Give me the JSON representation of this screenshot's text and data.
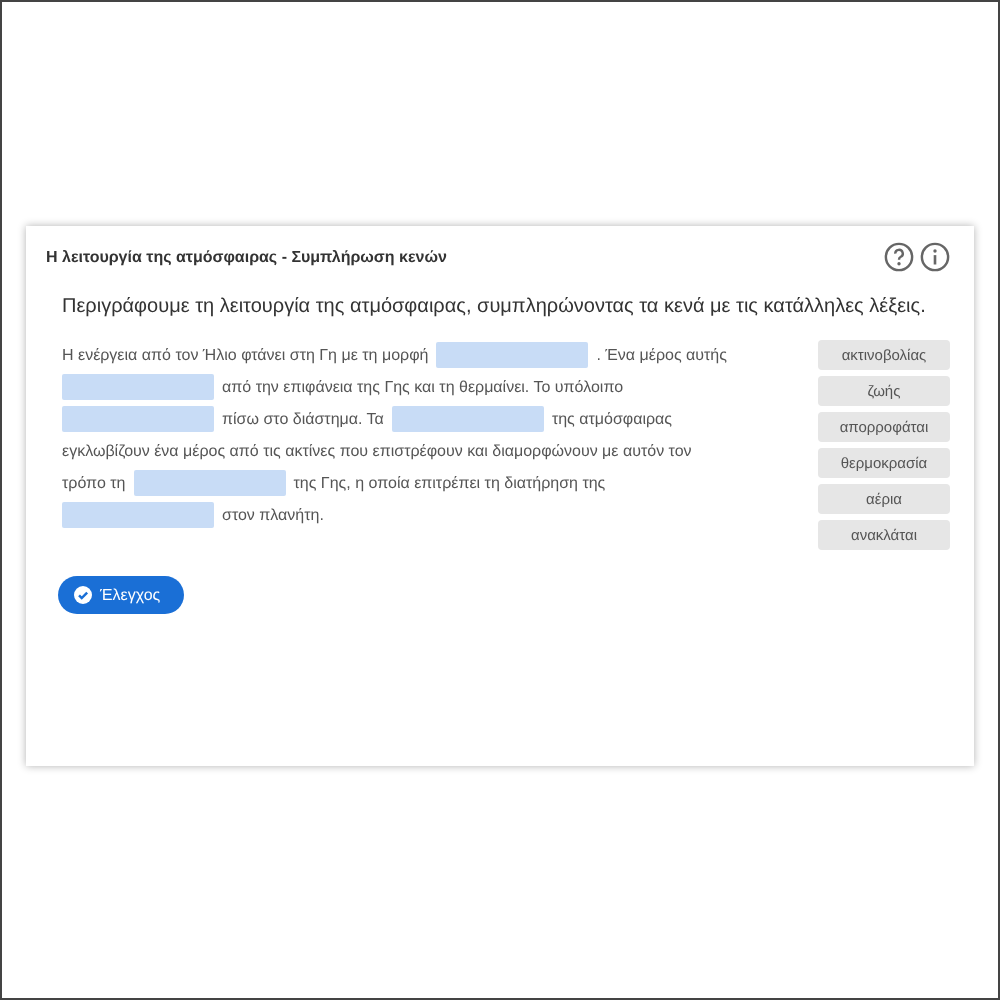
{
  "title": "Η λειτουργία της ατμόσφαιρας - Συμπλήρωση κενών",
  "instruction": "Περιγράφουμε τη λειτουργία της ατμόσφαιρας, συμπληρώνοντας τα κενά με τις κατάλληλες λέξεις.",
  "passage_lines": [
    [
      {
        "kind": "text",
        "text": "Η ενέργεια από τον Ήλιο φτάνει στη Γη με τη μορφή"
      },
      {
        "kind": "blank"
      },
      {
        "kind": "text",
        "text": ". Ένα μέρος αυτής"
      }
    ],
    [
      {
        "kind": "blank"
      },
      {
        "kind": "text",
        "text": "από την επιφάνεια της Γης και τη θερμαίνει. Το υπόλοιπο"
      }
    ],
    [
      {
        "kind": "blank"
      },
      {
        "kind": "text",
        "text": "πίσω στο διάστημα. Τα"
      },
      {
        "kind": "blank"
      },
      {
        "kind": "text",
        "text": "της ατμόσφαιρας"
      }
    ],
    [
      {
        "kind": "text",
        "text": "εγκλωβίζουν ένα μέρος από τις ακτίνες που επιστρέφουν και διαμορφώνουν με αυτόν τον"
      }
    ],
    [
      {
        "kind": "text",
        "text": "τρόπο τη"
      },
      {
        "kind": "blank"
      },
      {
        "kind": "text",
        "text": "της Γης, η οποία επιτρέπει τη διατήρηση της"
      }
    ],
    [
      {
        "kind": "blank"
      },
      {
        "kind": "text",
        "text": "στον πλανήτη."
      }
    ]
  ],
  "word_bank": [
    "ακτινοβολίας",
    "ζωής",
    "απορροφάται",
    "θερμοκρασία",
    "αέρια",
    "ανακλάται"
  ],
  "check_button": "Έλεγχος"
}
